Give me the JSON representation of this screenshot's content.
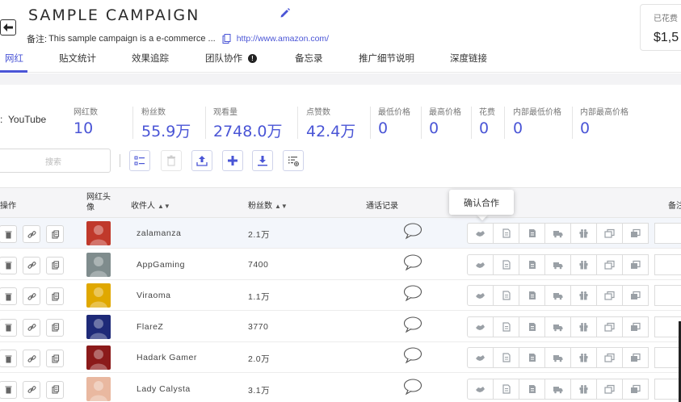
{
  "header": {
    "title": "SAMPLE CAMPAIGN",
    "note_label": "备注:",
    "note_text": "This sample campaign is a e-commerce ...",
    "note_link": "http://www.amazon.com/",
    "spent_label": "已花费",
    "spent_value": "$1,5"
  },
  "tabs": [
    {
      "label": "网红"
    },
    {
      "label": "贴文统计"
    },
    {
      "label": "效果追踪"
    },
    {
      "label": "团队协作"
    },
    {
      "label": "备忘录"
    },
    {
      "label": "推广细节说明"
    },
    {
      "label": "深度链接"
    }
  ],
  "platform": {
    "label": "YouTube",
    "prefix": ":"
  },
  "stats": [
    {
      "label": "网红数",
      "value": "10"
    },
    {
      "label": "粉丝数",
      "value": "55.9万"
    },
    {
      "label": "观看量",
      "value": "2748.0万"
    },
    {
      "label": "点赞数",
      "value": "42.4万"
    },
    {
      "label": "最低价格",
      "value": "0"
    },
    {
      "label": "最高价格",
      "value": "0"
    },
    {
      "label": "花费",
      "value": "0"
    },
    {
      "label": "内部最低价格",
      "value": "0"
    },
    {
      "label": "内部最高价格",
      "value": "0"
    }
  ],
  "search": {
    "placeholder": "搜索"
  },
  "table": {
    "headers": {
      "ops": "操作",
      "avatar": "网红头像",
      "recipient": "收件人",
      "fans": "粉丝数",
      "calls": "通话记录",
      "notes": "备注"
    },
    "rows": [
      {
        "name": "zalamanza",
        "fans": "2.1万",
        "avatar_color": "#c0392b"
      },
      {
        "name": "AppGaming",
        "fans": "7400",
        "avatar_color": "#7f8c8d"
      },
      {
        "name": "Viraoma",
        "fans": "1.1万",
        "avatar_color": "#e0a800"
      },
      {
        "name": "FlareZ",
        "fans": "3770",
        "avatar_color": "#1e2a78"
      },
      {
        "name": "Hadark Gamer",
        "fans": "2.0万",
        "avatar_color": "#8b1a1a"
      },
      {
        "name": "Lady Calysta",
        "fans": "3.1万",
        "avatar_color": "#e9b8a0"
      }
    ]
  },
  "tooltip": {
    "text": "确认合作"
  },
  "colors": {
    "accent": "#4a55d6"
  }
}
